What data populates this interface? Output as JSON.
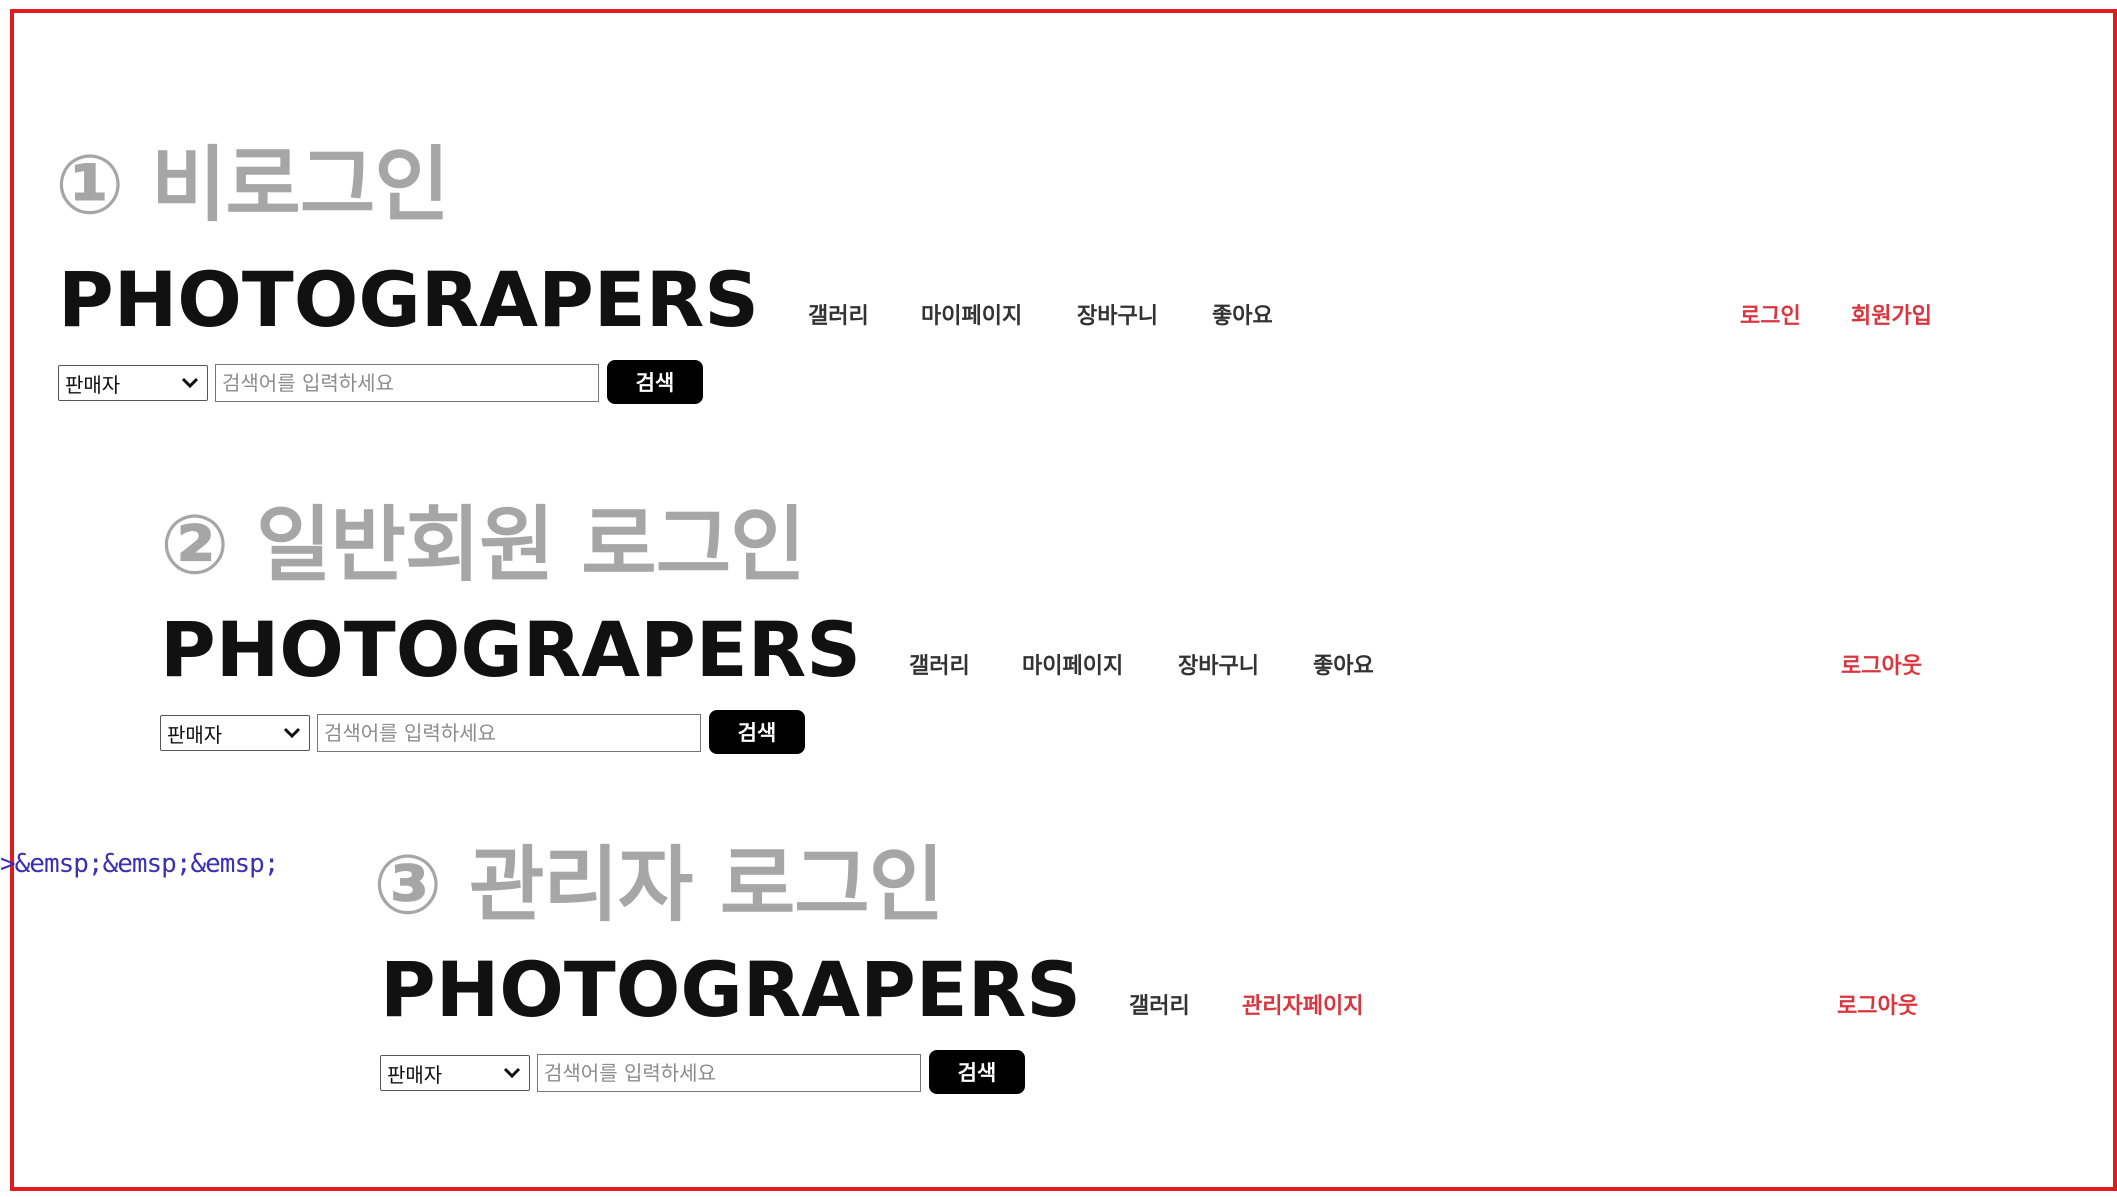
{
  "sections": [
    {
      "title": "① 비로그인",
      "logo": "PHOTOGRAPERS",
      "nav": [
        "갤러리",
        "마이페이지",
        "장바구니",
        "좋아요"
      ],
      "auth": [
        "로그인",
        "회원가입"
      ],
      "search": {
        "select_value": "판매자",
        "placeholder": "검색어를 입력하세요",
        "button_label": "검색"
      }
    },
    {
      "title": "② 일반회원 로그인",
      "logo": "PHOTOGRAPERS",
      "nav": [
        "갤러리",
        "마이페이지",
        "장바구니",
        "좋아요"
      ],
      "auth": [
        "로그아웃"
      ],
      "search": {
        "select_value": "판매자",
        "placeholder": "검색어를 입력하세요",
        "button_label": "검색"
      }
    },
    {
      "title": "③ 관리자 로그인",
      "logo": "PHOTOGRAPERS",
      "nav": [
        "갤러리",
        "관리자페이지"
      ],
      "auth": [
        "로그아웃"
      ],
      "search": {
        "select_value": "판매자",
        "placeholder": "검색어를 입력하세요",
        "button_label": "검색"
      }
    }
  ],
  "code_fragment": ">&emsp;&emsp;&emsp;",
  "colors": {
    "frame_border": "#e31b1b",
    "section_title": "#a6a6a6",
    "logo": "#111111",
    "nav_text": "#333333",
    "accent_red": "#d9363e",
    "button_bg": "#000000",
    "code_text": "#3d2fb5"
  },
  "icons": {
    "select_arrow": "chevron-down-icon"
  }
}
